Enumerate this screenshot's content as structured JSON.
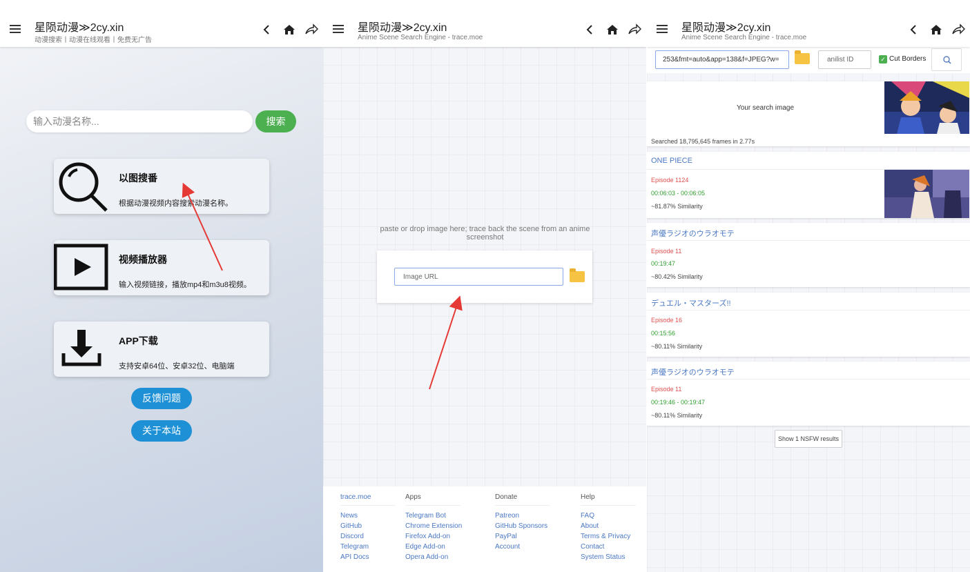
{
  "colors": {
    "search_green": "#4caf50",
    "pill_blue": "#1e90d6",
    "link_blue": "#4a78c4",
    "episode_red": "#e05050",
    "time_green": "#2e9e2e",
    "annotation_arrow": "#e53935"
  },
  "panel1": {
    "title": "星陨动漫≫2cy.xin",
    "subtitle": "动漫搜索丨动漫在线观看丨免费无广告",
    "search_placeholder": "输入动漫名称...",
    "search_button": "搜索",
    "features": [
      {
        "icon": "magnifier-icon",
        "title": "以图搜番",
        "desc": "根据动漫视频内容搜索动漫名称。"
      },
      {
        "icon": "play-icon",
        "title": "视频播放器",
        "desc": "输入视频链接，播放mp4和m3u8视频。"
      },
      {
        "icon": "download-icon",
        "title": "APP下载",
        "desc": "支持安卓64位、安卓32位、电脑端"
      }
    ],
    "feedback_button": "反馈问题",
    "about_button": "关于本站"
  },
  "panel2": {
    "title": "星陨动漫≫2cy.xin",
    "subtitle": "Anime Scene Search Engine - trace.moe",
    "drop_hint": "paste or drop image here; trace back the scene from an anime screenshot",
    "url_placeholder": "Image URL",
    "footer": {
      "columns": [
        {
          "heading": "trace.moe",
          "links": [
            "News",
            "GitHub",
            "Discord",
            "Telegram",
            "API Docs"
          ]
        },
        {
          "heading": "Apps",
          "links": [
            "Telegram Bot",
            "Chrome Extension",
            "Firefox Add-on",
            "Edge Add-on",
            "Opera Add-on"
          ]
        },
        {
          "heading": "Donate",
          "links": [
            "Patreon",
            "GitHub Sponsors",
            "PayPal",
            "Account"
          ]
        },
        {
          "heading": "Help",
          "links": [
            "FAQ",
            "About",
            "Terms & Privacy",
            "Contact",
            "System Status"
          ]
        }
      ]
    }
  },
  "panel3": {
    "title": "星陨动漫≫2cy.xin",
    "subtitle": "Anime Scene Search Engine - trace.moe",
    "url_value": "253&fmt=auto&app=138&f=JPEG?w=",
    "anilist_placeholder": "anilist ID",
    "cut_borders_label": "Cut Borders",
    "your_image_label": "Your search image",
    "search_stats": "Searched 18,795,645 frames in 2.77s",
    "results": [
      {
        "title": "ONE PIECE",
        "episode": "Episode 1124",
        "time": "00:06:03 - 00:06:05",
        "similarity": "~81.87% Similarity"
      },
      {
        "title": "声優ラジオのウラオモテ",
        "episode": "Episode 11",
        "time": "00:19:47",
        "similarity": "~80.42% Similarity"
      },
      {
        "title": "デュエル・マスターズ!!",
        "episode": "Episode 16",
        "time": "00:15:56",
        "similarity": "~80.11% Similarity"
      },
      {
        "title": "声優ラジオのウラオモテ",
        "episode": "Episode 11",
        "time": "00:19:46 - 00:19:47",
        "similarity": "~80.11% Similarity"
      }
    ],
    "nsfw_button": "Show 1 NSFW results"
  }
}
